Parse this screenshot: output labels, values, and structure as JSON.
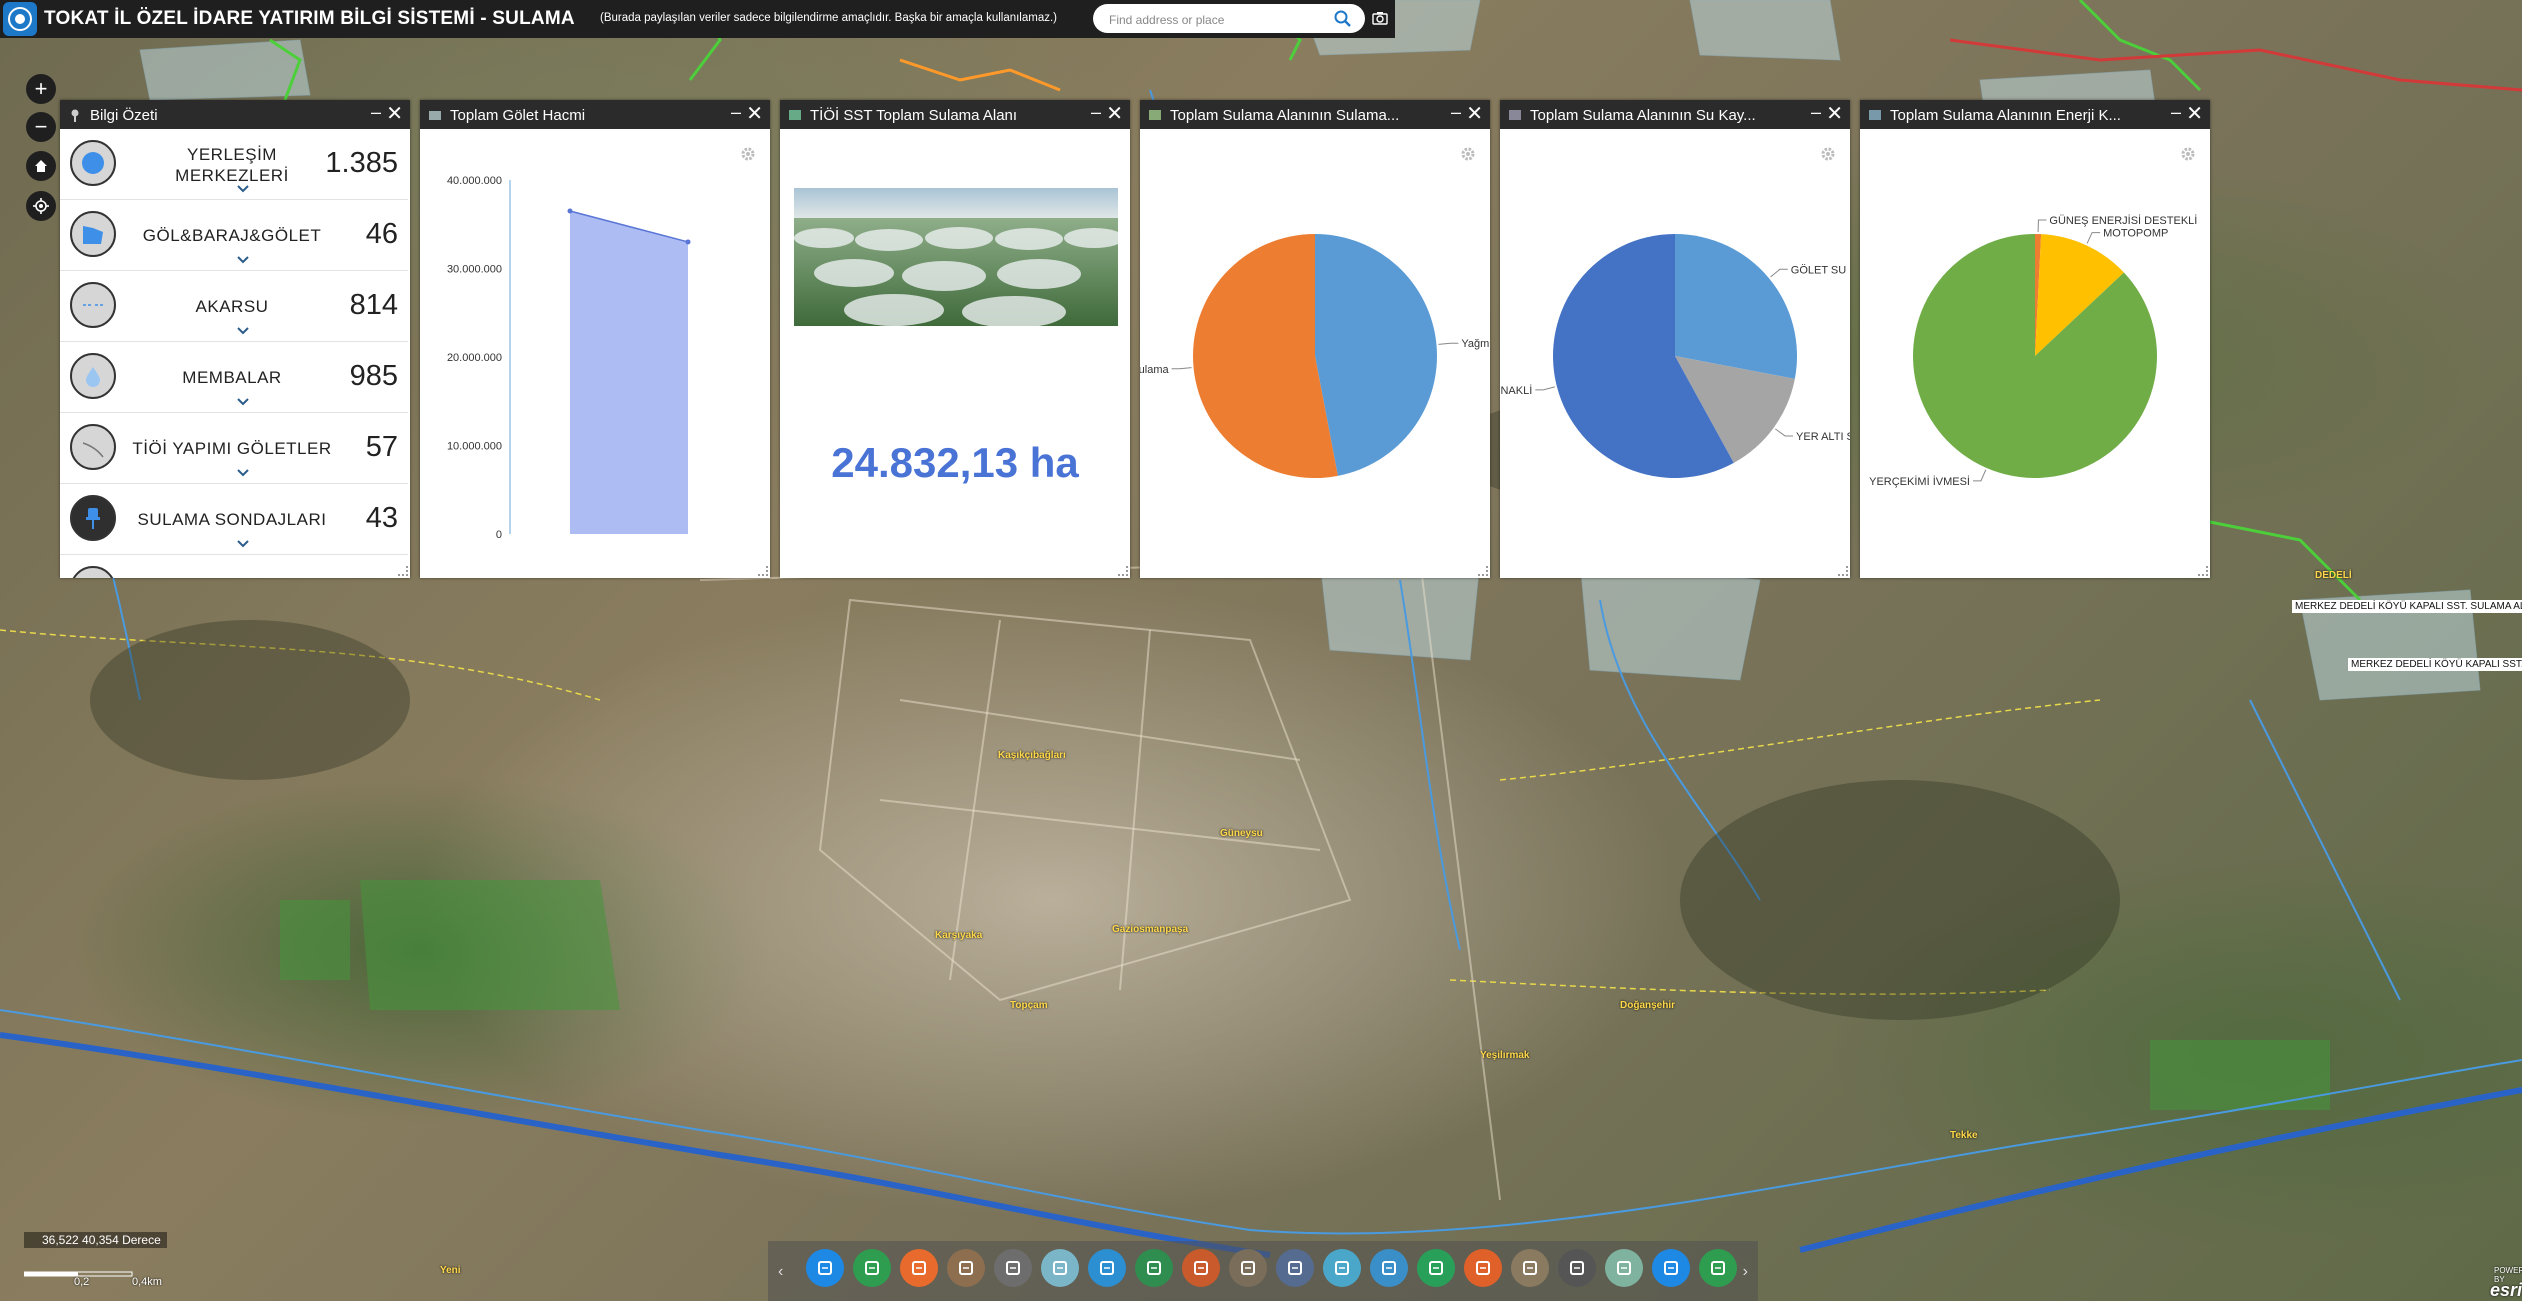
{
  "header": {
    "title": "TOKAT İL ÖZEL İDARE YATIRIM BİLGİ SİSTEMİ - SULAMA",
    "subtitle": "(Burada paylaşılan veriler sadece bilgilendirme amaçlıdır. Başka bir amaçla kullanılamaz.)",
    "search_placeholder": "Find address or place"
  },
  "map_controls": {
    "zoom_in": "+",
    "zoom_out": "−"
  },
  "panels": {
    "summary": {
      "title": "Bilgi Özeti",
      "items": [
        {
          "label": "YERLEŞİM MERKEZLERİ",
          "value": "1.385",
          "icon": "settlement-icon"
        },
        {
          "label": "GÖL&BARAJ&GÖLET",
          "value": "46",
          "icon": "lake-icon"
        },
        {
          "label": "AKARSU",
          "value": "814",
          "icon": "river-icon"
        },
        {
          "label": "MEMBALAR",
          "value": "985",
          "icon": "water-drop-icon"
        },
        {
          "label": "TİÖİ YAPIMI GÖLETLER",
          "value": "57",
          "icon": "pond-icon"
        },
        {
          "label": "SULAMA SONDAJLARI",
          "value": "43",
          "icon": "pin-icon"
        }
      ]
    },
    "pond_volume": {
      "title": "Toplam Gölet Hacmi"
    },
    "irrigation_area": {
      "title": "TİÖİ SST Toplam Sulama Alanı",
      "value": "24.832,13 ha"
    },
    "irrigation_type": {
      "title": "Toplam Sulama Alanının Sulama..."
    },
    "water_source": {
      "title": "Toplam Sulama Alanının Su Kay..."
    },
    "energy": {
      "title": "Toplam Sulama Alanının Enerji K..."
    }
  },
  "chart_data": [
    {
      "type": "area",
      "panel": "Toplam Gölet Hacmi",
      "y_ticks": [
        "0",
        "10.000.000",
        "20.000.000",
        "30.000.000",
        "40.000.000"
      ],
      "ylim": [
        0,
        40000000
      ],
      "values": [
        36500000,
        33000000
      ],
      "color": "#aebcf4",
      "line_color": "#5a76d6"
    },
    {
      "type": "pie",
      "panel": "Toplam Sulama Alanının Sulama...",
      "labels": [
        "Yağmu",
        "ulama"
      ],
      "values": [
        47,
        53
      ],
      "colors": [
        "#5b9bd5",
        "#ed7d31"
      ]
    },
    {
      "type": "pie",
      "panel": "Toplam Sulama Alanının Su Kay...",
      "labels": [
        "GÖLET SU",
        "YER ALTI SUYU",
        "NAKLİ"
      ],
      "values": [
        28,
        14,
        58
      ],
      "colors": [
        "#5b9bd5",
        "#a5a5a5",
        "#4472c4"
      ]
    },
    {
      "type": "pie",
      "panel": "Toplam Sulama Alanının Enerji K...",
      "labels": [
        "GÜNEŞ ENERJİSİ DESTEKLİ",
        "MOTOPOMP",
        "YERÇEKİMİ İVMESİ"
      ],
      "values": [
        0.8,
        12.2,
        87
      ],
      "colors": [
        "#ed7d31",
        "#ffc000",
        "#70ad47"
      ]
    }
  ],
  "status": {
    "coords": "36,522 40,354 Derece",
    "scale_mid": "0,2",
    "scale_end": "0,4km",
    "powered": "POWERED BY",
    "esri": "esri"
  },
  "map_labels": [
    "Kaşıkçıbağları",
    "Güneysu",
    "Karşıyaka",
    "Gaziosmanpaşa",
    "Topçam",
    "Yeşilırmak",
    "Doğanşehir",
    "Tekke",
    "Yeni",
    "DEDELİ"
  ],
  "map_tags": [
    "MERKEZ DEDELİ KÖYÜ KAPALI SST. SULAMA ALANI",
    "MERKEZ DEDELİ KÖYÜ KAPALI SST. SU"
  ],
  "dock_colors": [
    "#1e88e5",
    "#2e9d4f",
    "#e86a2c",
    "#8d6e4f",
    "#6d6d6d",
    "#7ab6c8",
    "#2b8fd1",
    "#2f8d4f",
    "#c95a2c",
    "#7a6e5a",
    "#556b8f",
    "#4aa7c9",
    "#3a8fc9",
    "#28a05a",
    "#e0602a",
    "#8a7a60",
    "#555555",
    "#7fb3a0",
    "#1e88e5",
    "#2e9d4f"
  ]
}
